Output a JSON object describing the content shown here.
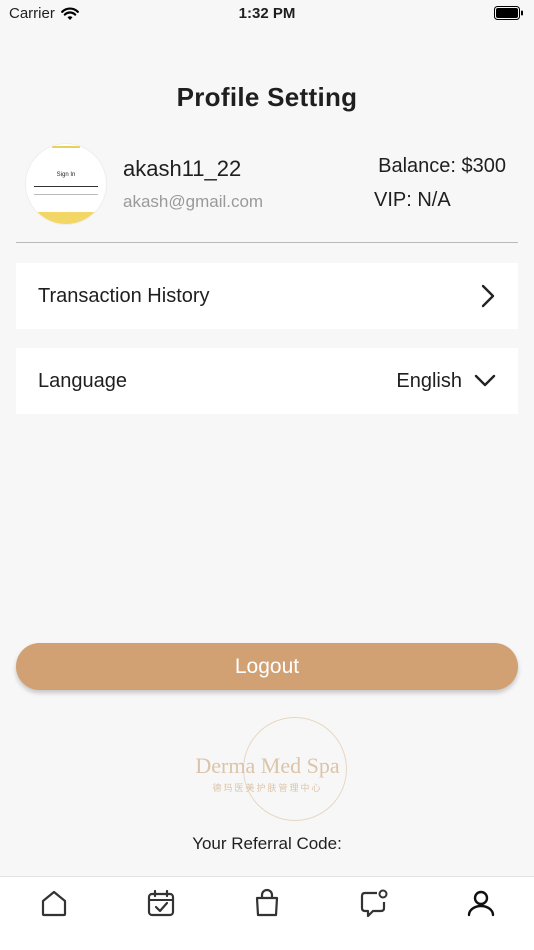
{
  "status_bar": {
    "carrier": "Carrier",
    "time": "1:32 PM"
  },
  "page_title": "Profile Setting",
  "profile": {
    "username": "akash11_22",
    "email": "akash@gmail.com",
    "balance": "Balance: $300",
    "vip": "VIP: N/A",
    "avatar_text": "Sign In"
  },
  "menu": {
    "transaction_history": "Transaction History",
    "language_label": "Language",
    "language_value": "English"
  },
  "logout_label": "Logout",
  "brand": {
    "name": "Derma Med Spa",
    "subtitle": "德玛医美护肤管理中心"
  },
  "referral_label": "Your Referral Code:",
  "tabs": [
    "home-icon",
    "calendar-icon",
    "shopping-bag-icon",
    "chat-icon",
    "profile-icon"
  ],
  "colors": {
    "accent": "#d1a174",
    "brand_text": "#dcc4aa"
  }
}
